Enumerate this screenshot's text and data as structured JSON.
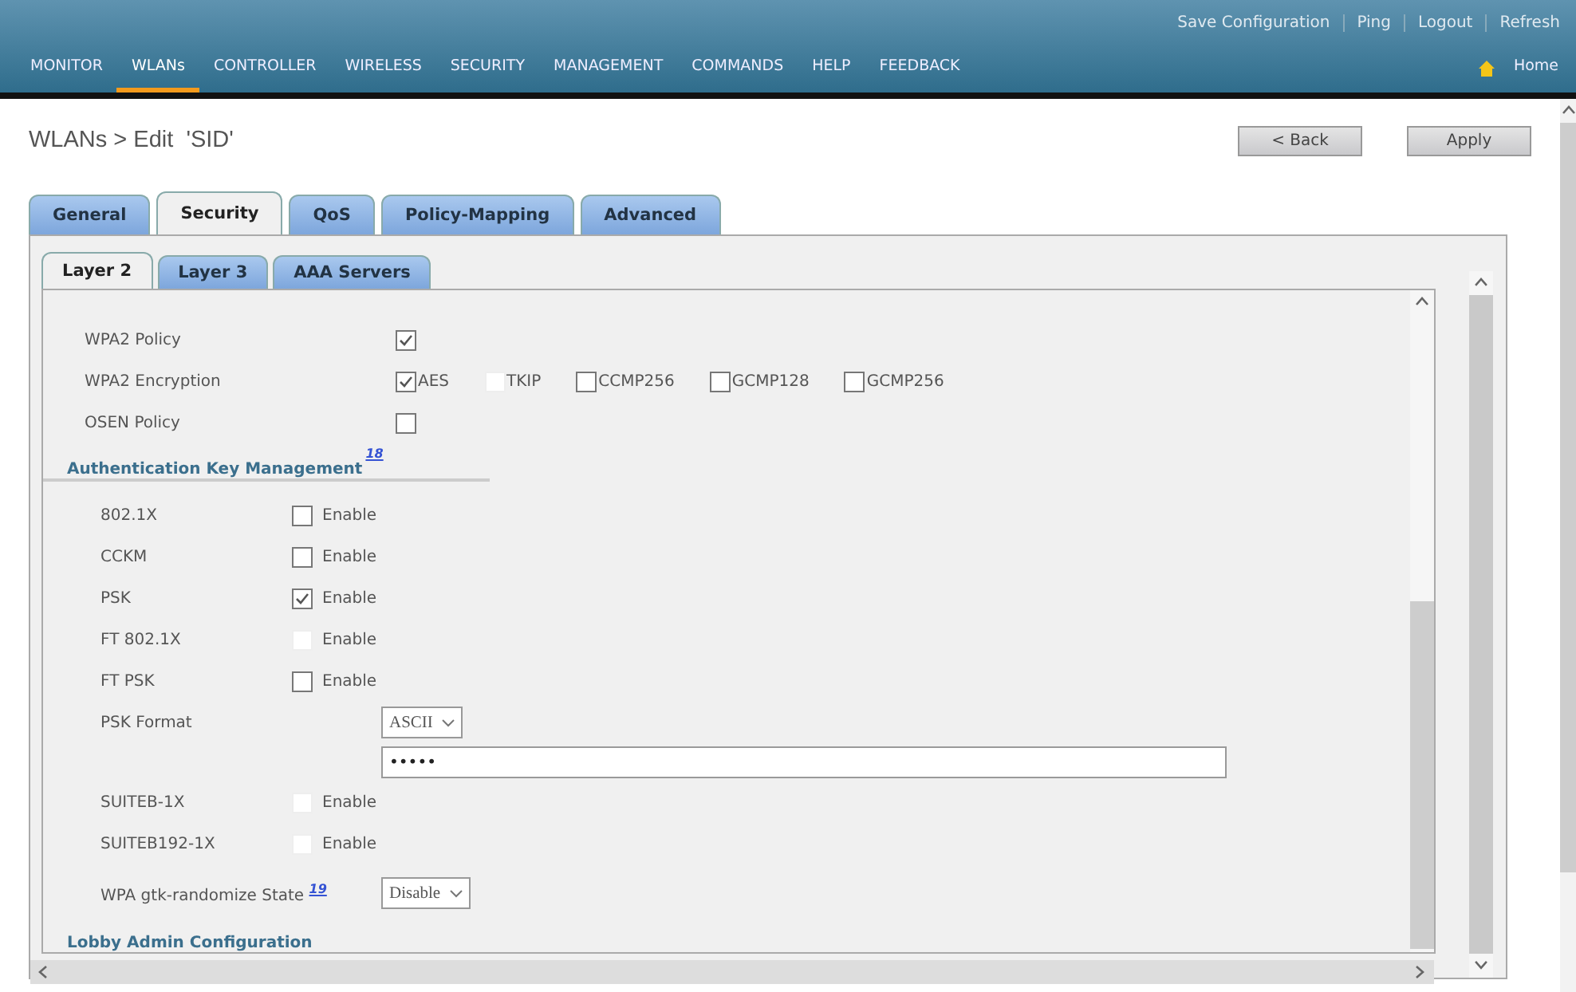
{
  "header": {
    "links": [
      "Save Configuration",
      "Ping",
      "Logout",
      "Refresh"
    ],
    "nav": [
      {
        "label": "MONITOR",
        "selected": false
      },
      {
        "label": "WLANs",
        "selected": true
      },
      {
        "label": "CONTROLLER",
        "selected": false
      },
      {
        "label": "WIRELESS",
        "selected": false
      },
      {
        "label": "SECURITY",
        "selected": false
      },
      {
        "label": "MANAGEMENT",
        "selected": false
      },
      {
        "label": "COMMANDS",
        "selected": false
      },
      {
        "label": "HELP",
        "selected": false
      },
      {
        "label": "FEEDBACK",
        "selected": false
      }
    ],
    "home": "Home"
  },
  "page": {
    "title": "WLANs > Edit  'SID'",
    "buttons": [
      "< Back",
      "Apply"
    ]
  },
  "tabs": [
    {
      "label": "General",
      "selected": false
    },
    {
      "label": "Security",
      "selected": true
    },
    {
      "label": "QoS",
      "selected": false
    },
    {
      "label": "Policy-Mapping",
      "selected": false
    },
    {
      "label": "Advanced",
      "selected": false
    }
  ],
  "subtabs": [
    {
      "label": "Layer 2",
      "selected": true
    },
    {
      "label": "Layer 3",
      "selected": false
    },
    {
      "label": "AAA Servers",
      "selected": false
    }
  ],
  "security_rows": [
    {
      "label": "WPA2 Policy",
      "options": [
        {
          "checked": true,
          "disabled": false
        }
      ]
    },
    {
      "label": "WPA2 Encryption",
      "options": [
        {
          "text": "AES",
          "checked": true,
          "disabled": false
        },
        {
          "text": "TKIP",
          "checked": false,
          "disabled": true
        },
        {
          "text": "CCMP256",
          "checked": false,
          "disabled": false
        },
        {
          "text": "GCMP128",
          "checked": false,
          "disabled": false
        },
        {
          "text": "GCMP256",
          "checked": false,
          "disabled": false
        }
      ]
    },
    {
      "label": "OSEN Policy",
      "options": [
        {
          "checked": false,
          "disabled": false
        }
      ]
    }
  ],
  "akm": {
    "heading": "Authentication Key Management",
    "help": "18",
    "rows": [
      {
        "kind": "checkbox",
        "label": "802.1X",
        "text": "Enable",
        "checked": false,
        "disabled": false
      },
      {
        "kind": "checkbox",
        "label": "CCKM",
        "text": "Enable",
        "checked": false,
        "disabled": false
      },
      {
        "kind": "checkbox",
        "label": "PSK",
        "text": "Enable",
        "checked": true,
        "disabled": false
      },
      {
        "kind": "checkbox",
        "label": "FT 802.1X",
        "text": "Enable",
        "checked": false,
        "disabled": true
      },
      {
        "kind": "checkbox",
        "label": "FT PSK",
        "text": "Enable",
        "checked": false,
        "disabled": false
      },
      {
        "kind": "select",
        "label": "PSK Format",
        "value": "ASCII"
      },
      {
        "kind": "password",
        "value": "•••••"
      },
      {
        "kind": "checkbox",
        "label": "SUITEB-1X",
        "text": "Enable",
        "checked": false,
        "disabled": true
      },
      {
        "kind": "checkbox",
        "label": "SUITEB192-1X",
        "text": "Enable",
        "checked": false,
        "disabled": true
      },
      {
        "kind": "select",
        "label": "WPA gtk-randomize State",
        "help": "19",
        "value": "Disable"
      }
    ]
  },
  "lobby": "Lobby Admin Configuration"
}
